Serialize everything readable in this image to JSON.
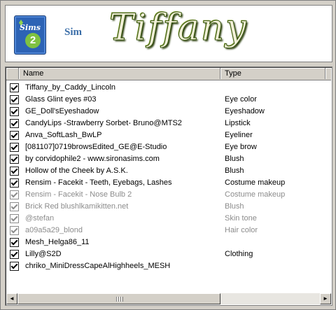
{
  "banner": {
    "logo_text": "Sims",
    "logo_number": "2",
    "sim_label": "Sim",
    "title": "Tiffany"
  },
  "list": {
    "columns": {
      "name": "Name",
      "type": "Type"
    },
    "rows": [
      {
        "name": "Tiffany_by_Caddy_Lincoln",
        "type": "",
        "checked": true,
        "dim": false
      },
      {
        "name": "Glass Glint eyes #03",
        "type": "Eye color",
        "checked": true,
        "dim": false
      },
      {
        "name": "GE_Doll'sEyeshadow",
        "type": "Eyeshadow",
        "checked": true,
        "dim": false
      },
      {
        "name": "CandyLips -Strawberry Sorbet- Bruno@MTS2",
        "type": "Lipstick",
        "checked": true,
        "dim": false
      },
      {
        "name": "Anva_SoftLash_BwLP",
        "type": "Eyeliner",
        "checked": true,
        "dim": false
      },
      {
        "name": "[081107]0719browsEdited_GE@E-Studio",
        "type": "Eye brow",
        "checked": true,
        "dim": false
      },
      {
        "name": "by corvidophile2 - www.sironasims.com",
        "type": "Blush",
        "checked": true,
        "dim": false
      },
      {
        "name": "Hollow of the Cheek by A.S.K.",
        "type": "Blush",
        "checked": true,
        "dim": false
      },
      {
        "name": "Rensim - Facekit - Teeth, Eyebags, Lashes",
        "type": "Costume makeup",
        "checked": true,
        "dim": false
      },
      {
        "name": "Rensim - Facekit - Nose Bulb 2",
        "type": "Costume makeup",
        "checked": true,
        "dim": true
      },
      {
        "name": "Brick Red blushlkamikitten.net",
        "type": "Blush",
        "checked": true,
        "dim": true
      },
      {
        "name": "@stefan",
        "type": "Skin tone",
        "checked": true,
        "dim": true
      },
      {
        "name": "a09a5a29_blond",
        "type": "Hair color",
        "checked": true,
        "dim": true
      },
      {
        "name": "Mesh_Helga86_11",
        "type": "",
        "checked": true,
        "dim": false
      },
      {
        "name": "Lilly@S2D",
        "type": "Clothing",
        "checked": true,
        "dim": false
      },
      {
        "name": "chriko_MiniDressCapeAlHighheels_MESH",
        "type": "",
        "checked": true,
        "dim": false
      }
    ]
  },
  "scrollbar": {
    "left_arrow": "◄",
    "right_arrow": "►"
  }
}
